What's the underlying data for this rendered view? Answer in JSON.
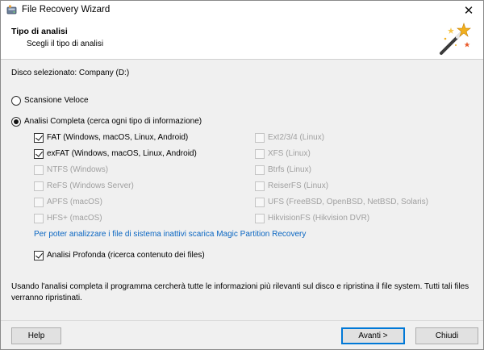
{
  "window": {
    "title": "File Recovery Wizard",
    "close_symbol": "✕"
  },
  "header": {
    "title": "Tipo di analisi",
    "subtitle": "Scegli il tipo di analisi"
  },
  "disk": {
    "label": "Disco selezionato: Company (D:)"
  },
  "options": {
    "fast_scan": {
      "label": "Scansione Veloce",
      "selected": false
    },
    "full_scan": {
      "label": "Analisi Completa (cerca ogni tipo di informazione)",
      "selected": true
    }
  },
  "filesystems_left": [
    {
      "label": "FAT (Windows, macOS, Linux, Android)",
      "checked": true,
      "enabled": true
    },
    {
      "label": "exFAT (Windows, macOS, Linux, Android)",
      "checked": true,
      "enabled": true
    },
    {
      "label": "NTFS (Windows)",
      "checked": false,
      "enabled": false
    },
    {
      "label": "ReFS (Windows Server)",
      "checked": false,
      "enabled": false
    },
    {
      "label": "APFS (macOS)",
      "checked": false,
      "enabled": false
    },
    {
      "label": "HFS+ (macOS)",
      "checked": false,
      "enabled": false
    }
  ],
  "filesystems_right": [
    {
      "label": "Ext2/3/4 (Linux)",
      "checked": false,
      "enabled": false
    },
    {
      "label": "XFS (Linux)",
      "checked": false,
      "enabled": false
    },
    {
      "label": "Btrfs (Linux)",
      "checked": false,
      "enabled": false
    },
    {
      "label": "ReiserFS (Linux)",
      "checked": false,
      "enabled": false
    },
    {
      "label": "UFS (FreeBSD, OpenBSD, NetBSD, Solaris)",
      "checked": false,
      "enabled": false
    },
    {
      "label": "HikvisionFS (Hikvision DVR)",
      "checked": false,
      "enabled": false
    }
  ],
  "link": {
    "text": "Per poter analizzare i file di sistema inattivi scarica Magic Partition Recovery"
  },
  "deep_scan": {
    "label": "Analisi Profonda (ricerca contenuto dei files)",
    "checked": true
  },
  "note": {
    "text": "Usando l'analisi completa il programma cercherà tutte le informazioni più rilevanti sul disco e ripristina il file system. Tutti tali files verranno ripristinati."
  },
  "buttons": {
    "help": "Help",
    "next": "Avanti >",
    "close": "Chiudi"
  },
  "icons": {
    "app": "disk-recovery-icon",
    "header": "magic-wand-icon"
  },
  "colors": {
    "link": "#0a66c2",
    "accent": "#0078d7",
    "disabled_text": "#a0a0a0"
  }
}
